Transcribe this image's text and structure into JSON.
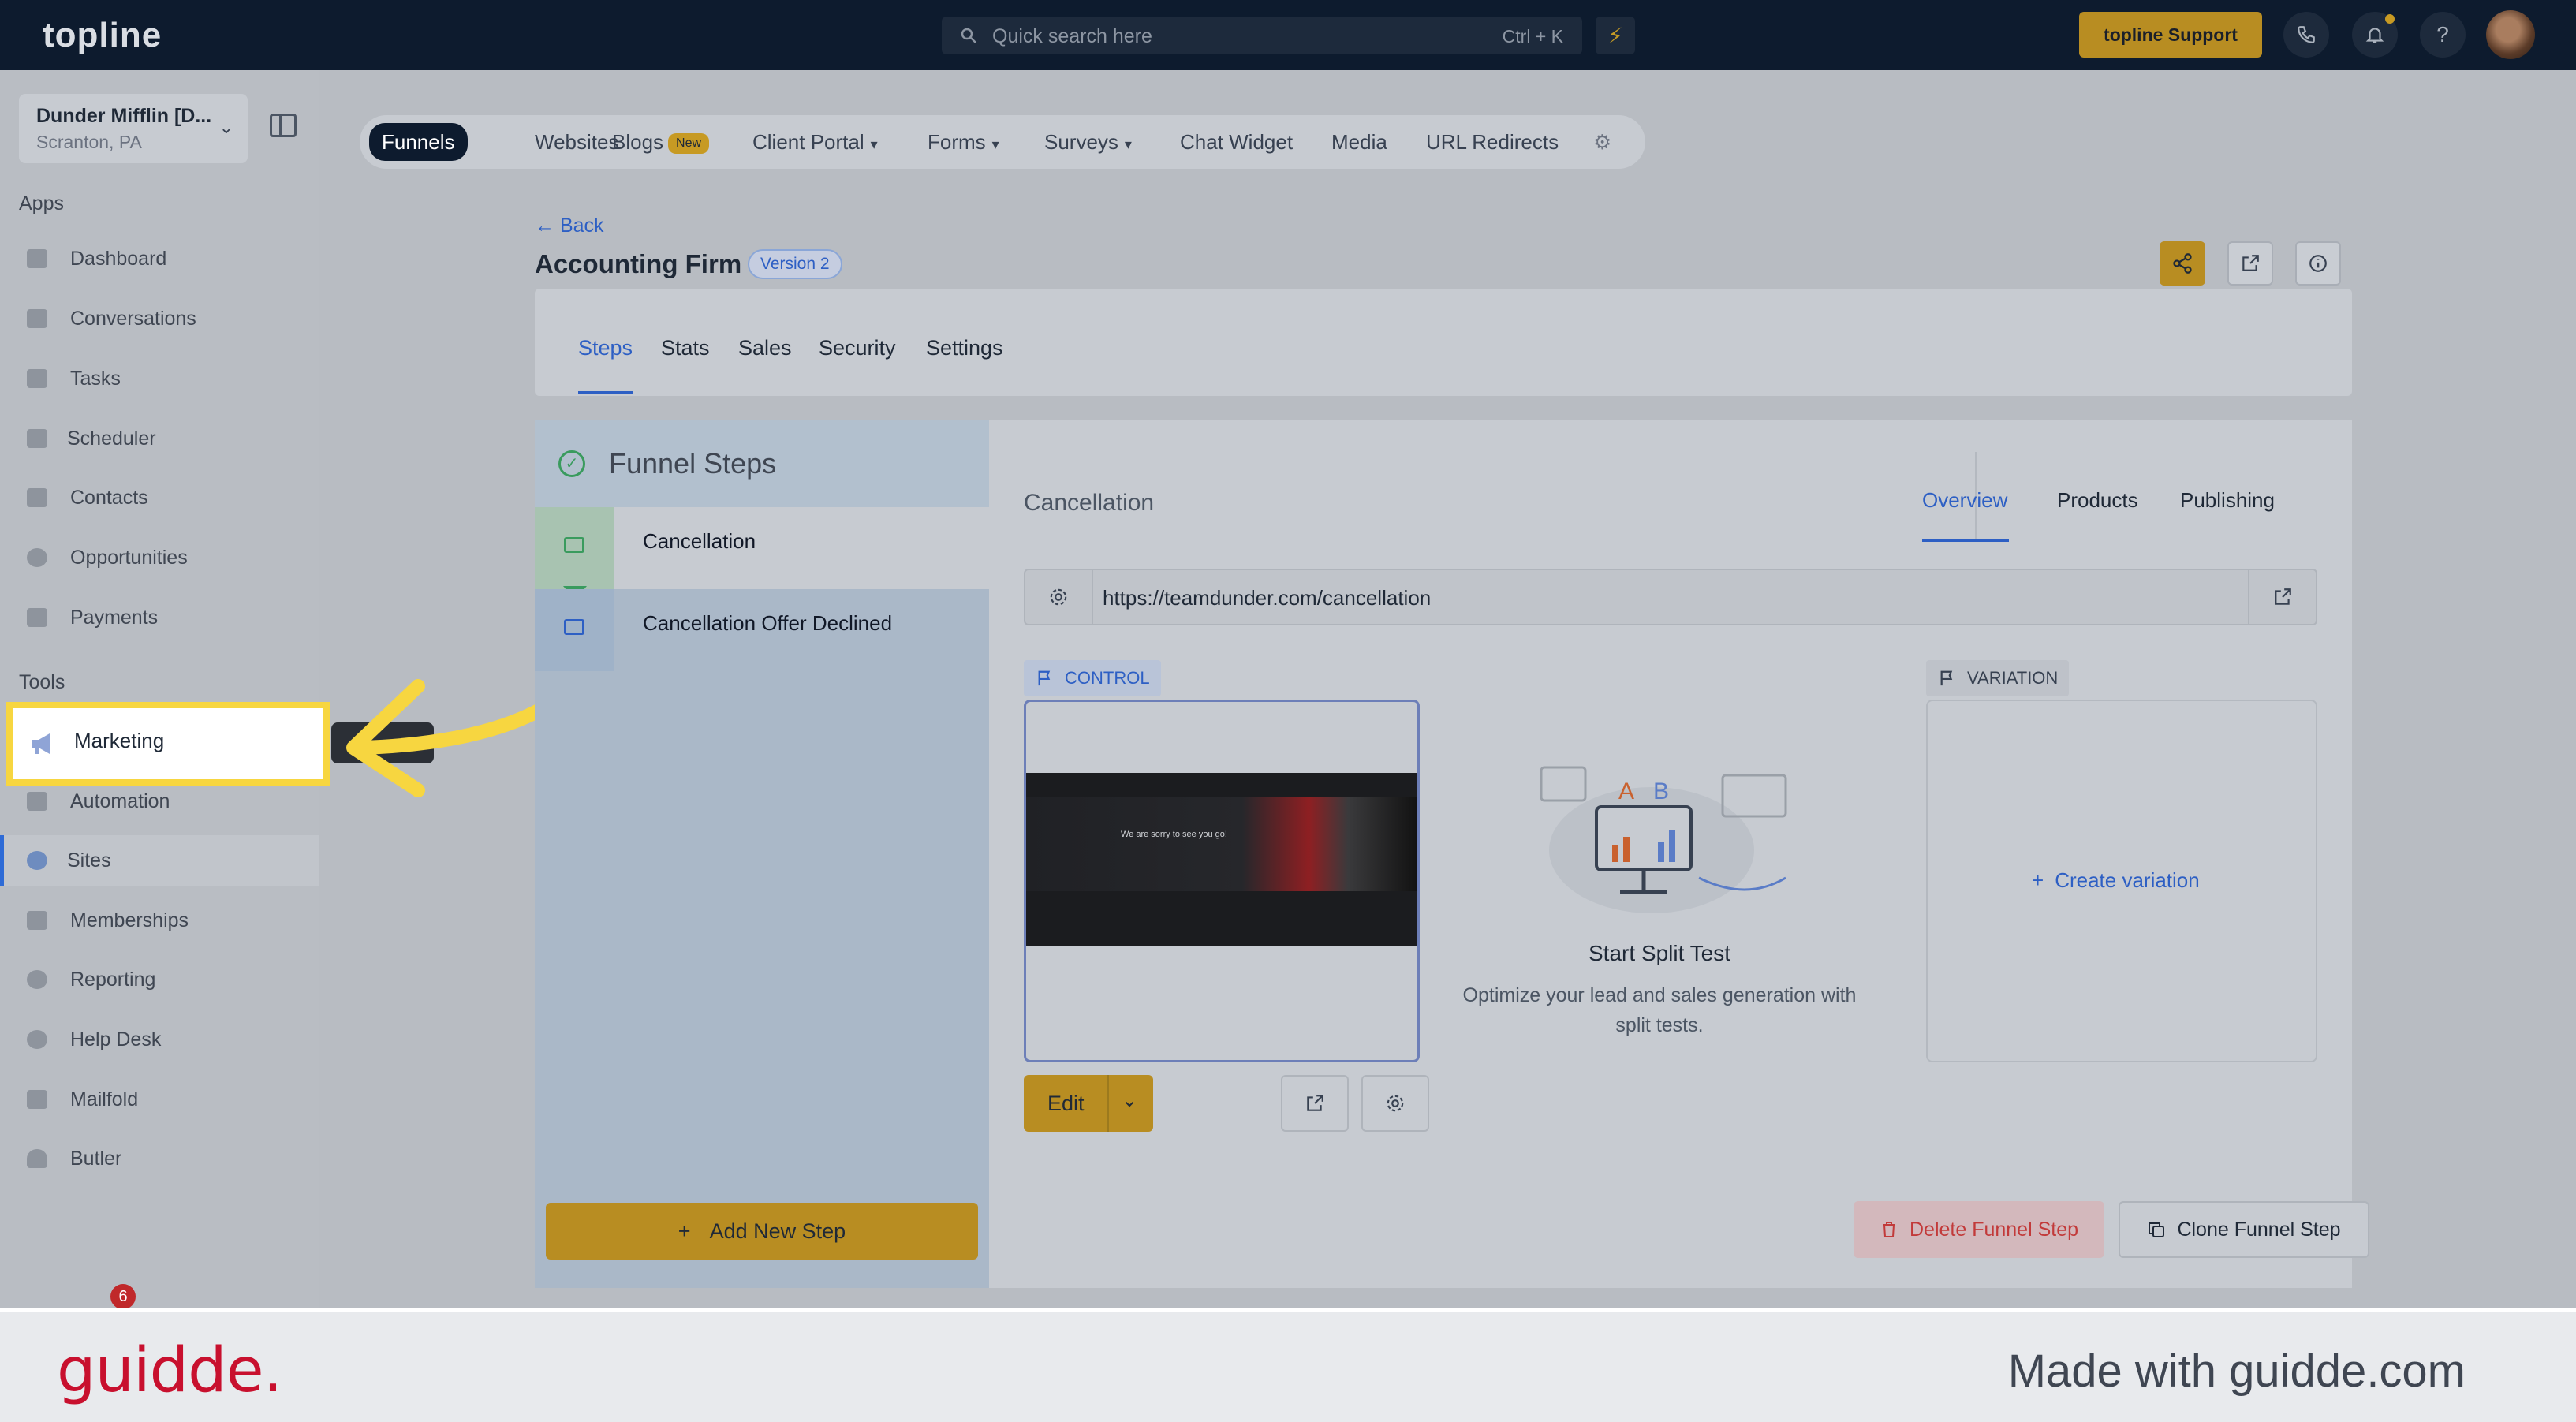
{
  "app": {
    "logo": "topline"
  },
  "topbar": {
    "search_placeholder": "Quick search here",
    "search_shortcut": "Ctrl + K",
    "support_label": "topline Support"
  },
  "sidebar": {
    "location_name": "Dunder Mifflin [D...",
    "location_city": "Scranton, PA",
    "apps_heading": "Apps",
    "tools_heading": "Tools",
    "apps": [
      {
        "label": "Dashboard",
        "icon": "dashboard-icon"
      },
      {
        "label": "Conversations",
        "icon": "chat-icon"
      },
      {
        "label": "Tasks",
        "icon": "tasks-icon"
      },
      {
        "label": "Scheduler",
        "icon": "calendar-icon"
      },
      {
        "label": "Contacts",
        "icon": "contacts-icon"
      },
      {
        "label": "Opportunities",
        "icon": "target-icon"
      },
      {
        "label": "Payments",
        "icon": "card-icon"
      }
    ],
    "tools": [
      {
        "label": "Marketing",
        "icon": "megaphone-icon"
      },
      {
        "label": "Automation",
        "icon": "gears-icon"
      },
      {
        "label": "Sites",
        "icon": "globe-icon"
      },
      {
        "label": "Memberships",
        "icon": "users-icon"
      },
      {
        "label": "Reporting",
        "icon": "pie-icon"
      },
      {
        "label": "Help Desk",
        "icon": "help-icon"
      },
      {
        "label": "Mailfold",
        "icon": "mail-icon"
      },
      {
        "label": "Butler",
        "icon": "butler-icon"
      }
    ],
    "notification_count": "6"
  },
  "subnav": {
    "items": [
      {
        "label": "Funnels"
      },
      {
        "label": "Websites"
      },
      {
        "label": "Blogs",
        "badge": "New"
      },
      {
        "label": "Client Portal"
      },
      {
        "label": "Forms"
      },
      {
        "label": "Surveys"
      },
      {
        "label": "Chat Widget"
      },
      {
        "label": "Media"
      },
      {
        "label": "URL Redirects"
      }
    ]
  },
  "header": {
    "back": "Back",
    "title": "Accounting Firm",
    "version": "Version 2",
    "tabs": [
      "Steps",
      "Stats",
      "Sales",
      "Security",
      "Settings"
    ]
  },
  "funnel": {
    "panel_title": "Funnel Steps",
    "steps": [
      "Cancellation",
      "Cancellation Offer Declined"
    ],
    "add_step": "Add New Step"
  },
  "detail": {
    "step_title": "Cancellation",
    "tabs": [
      "Overview",
      "Products",
      "Publishing"
    ],
    "url": "https://teamdunder.com/cancellation",
    "control_tag": "CONTROL",
    "variation_tag": "VARIATION",
    "thumb_text": "We are sorry to see you go!",
    "edit": "Edit",
    "split_title": "Start Split Test",
    "split_desc": "Optimize your lead and sales generation with split tests.",
    "create_variation": "Create variation",
    "delete_step": "Delete Funnel Step",
    "clone_step": "Clone Funnel Step"
  },
  "footer": {
    "brand": "guidde.",
    "made_with": "Made with guidde.com"
  },
  "colors": {
    "accent": "#2d5fc4",
    "gold": "#b88d22",
    "highlight": "#f7d640",
    "brand_red": "#c8102e"
  }
}
